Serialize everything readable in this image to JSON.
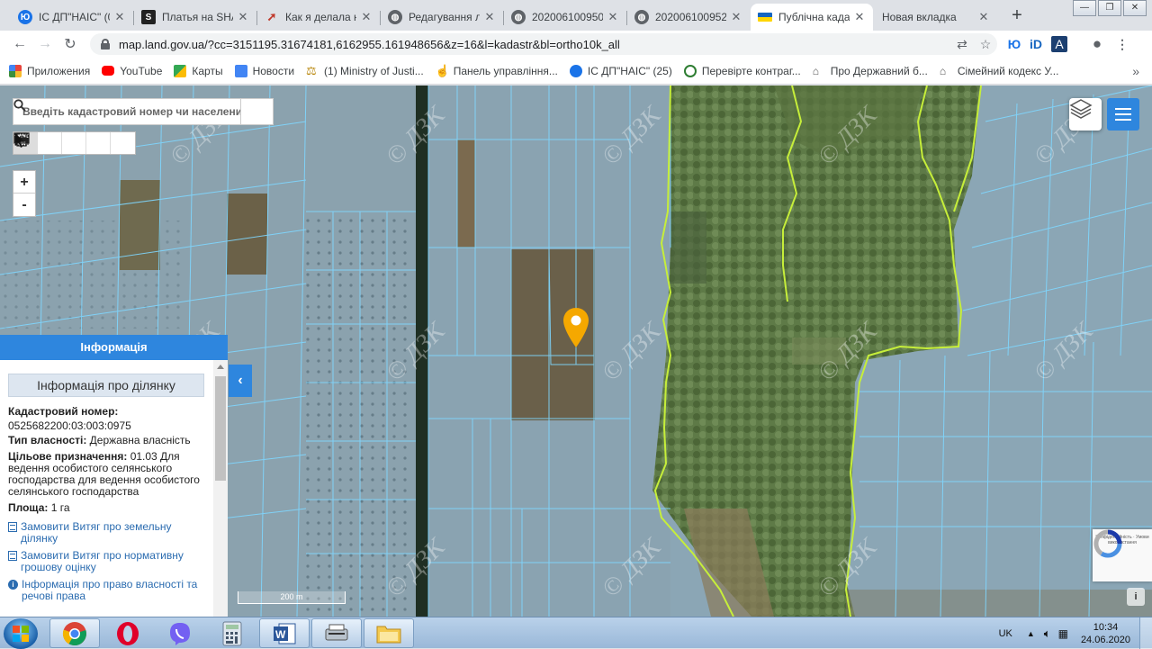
{
  "browser": {
    "tabs": [
      {
        "label": "ІС ДП\"НАІС\" (0",
        "favicon": "nais-icon",
        "color": "#1a73e8",
        "glyph": "Ю"
      },
      {
        "label": "Платья на SHA",
        "favicon": "shafa-icon",
        "color": "#222222",
        "glyph": "S"
      },
      {
        "label": "Как я делала н",
        "favicon": "paper-plane-icon",
        "color": "#c0392b",
        "glyph": "➚"
      },
      {
        "label": "Редагування л",
        "favicon": "globe-icon",
        "color": "#5f6368",
        "glyph": "◍"
      },
      {
        "label": "2020061009505",
        "favicon": "globe-icon",
        "color": "#5f6368",
        "glyph": "◍"
      },
      {
        "label": "2020061009523",
        "favicon": "globe-icon",
        "color": "#5f6368",
        "glyph": "◍"
      },
      {
        "label": "Публічна када",
        "favicon": "ukraine-flag-icon",
        "color": "#ffd500",
        "glyph": ""
      },
      {
        "label": "Новая вкладка",
        "favicon": "",
        "color": "",
        "glyph": ""
      }
    ],
    "active_tab": 6,
    "new_tab": "+",
    "url": "map.land.gov.ua/?cc=3151195.31674181,6162955.161948656&z=16&l=kadastr&bl=ortho10k_all",
    "bookmarks": [
      {
        "label": "Приложения",
        "icon": "apps-grid-icon",
        "color": "#e8453c"
      },
      {
        "label": "YouTube",
        "icon": "youtube-icon",
        "color": "#ff0000"
      },
      {
        "label": "Карты",
        "icon": "maps-icon",
        "color": "#34a853"
      },
      {
        "label": "Новости",
        "icon": "news-icon",
        "color": "#4285f4"
      },
      {
        "label": "(1) Ministry of Justi...",
        "icon": "scales-icon",
        "color": "#b8860b"
      },
      {
        "label": "Панель управління...",
        "icon": "hand-icon",
        "color": "#f0a020"
      },
      {
        "label": "ІС ДП\"НАІС\" (25)",
        "icon": "nais-icon",
        "color": "#1a73e8"
      },
      {
        "label": "Перевірте контраг...",
        "icon": "check-icon",
        "color": "#2e7d32"
      },
      {
        "label": "Про Державний б...",
        "icon": "building-icon",
        "color": "#555555"
      },
      {
        "label": "Сімейний кодекс У...",
        "icon": "building-icon",
        "color": "#555555"
      }
    ],
    "bookmarks_more": "»"
  },
  "map": {
    "search_placeholder": "Введіть кадастровий номер чи населений",
    "zoom_in": "+",
    "zoom_out": "-",
    "scale_label": "200 m",
    "watermark": "© ДЗК",
    "collapse_glyph": "‹",
    "captcha_text": "Конфіденційність · Умови використання",
    "info_glyph": "i"
  },
  "panel": {
    "title": "Інформація",
    "subtitle": "Інформація про ділянку",
    "cadastral_label": "Кадастровий номер:",
    "cadastral_value": "0525682200:03:003:0975",
    "ownership_label": "Тип власності:",
    "ownership_value": "Державна власність",
    "purpose_label": "Цільове призначення:",
    "purpose_value": "01.03 Для ведення особистого селянського господарства для ведення особистого селянського господарства",
    "area_label": "Площа:",
    "area_value": "1 га",
    "links": [
      "Замовити Витяг про земельну ділянку",
      "Замовити Витяг про нормативну грошову оцінку",
      "Інформація про право власності та речові права"
    ]
  },
  "taskbar": {
    "apps": [
      "chrome-icon",
      "opera-icon",
      "viber-icon",
      "calculator-icon",
      "word-icon",
      "scanner-icon",
      "folder-icon"
    ],
    "lang": "UK",
    "time": "10:34",
    "date": "24.06.2020"
  },
  "colors": {
    "accent": "#2e86de",
    "parcel_line": "#7fd7ff",
    "boundary": "#c6ee3a",
    "marker": "#f5a800"
  }
}
